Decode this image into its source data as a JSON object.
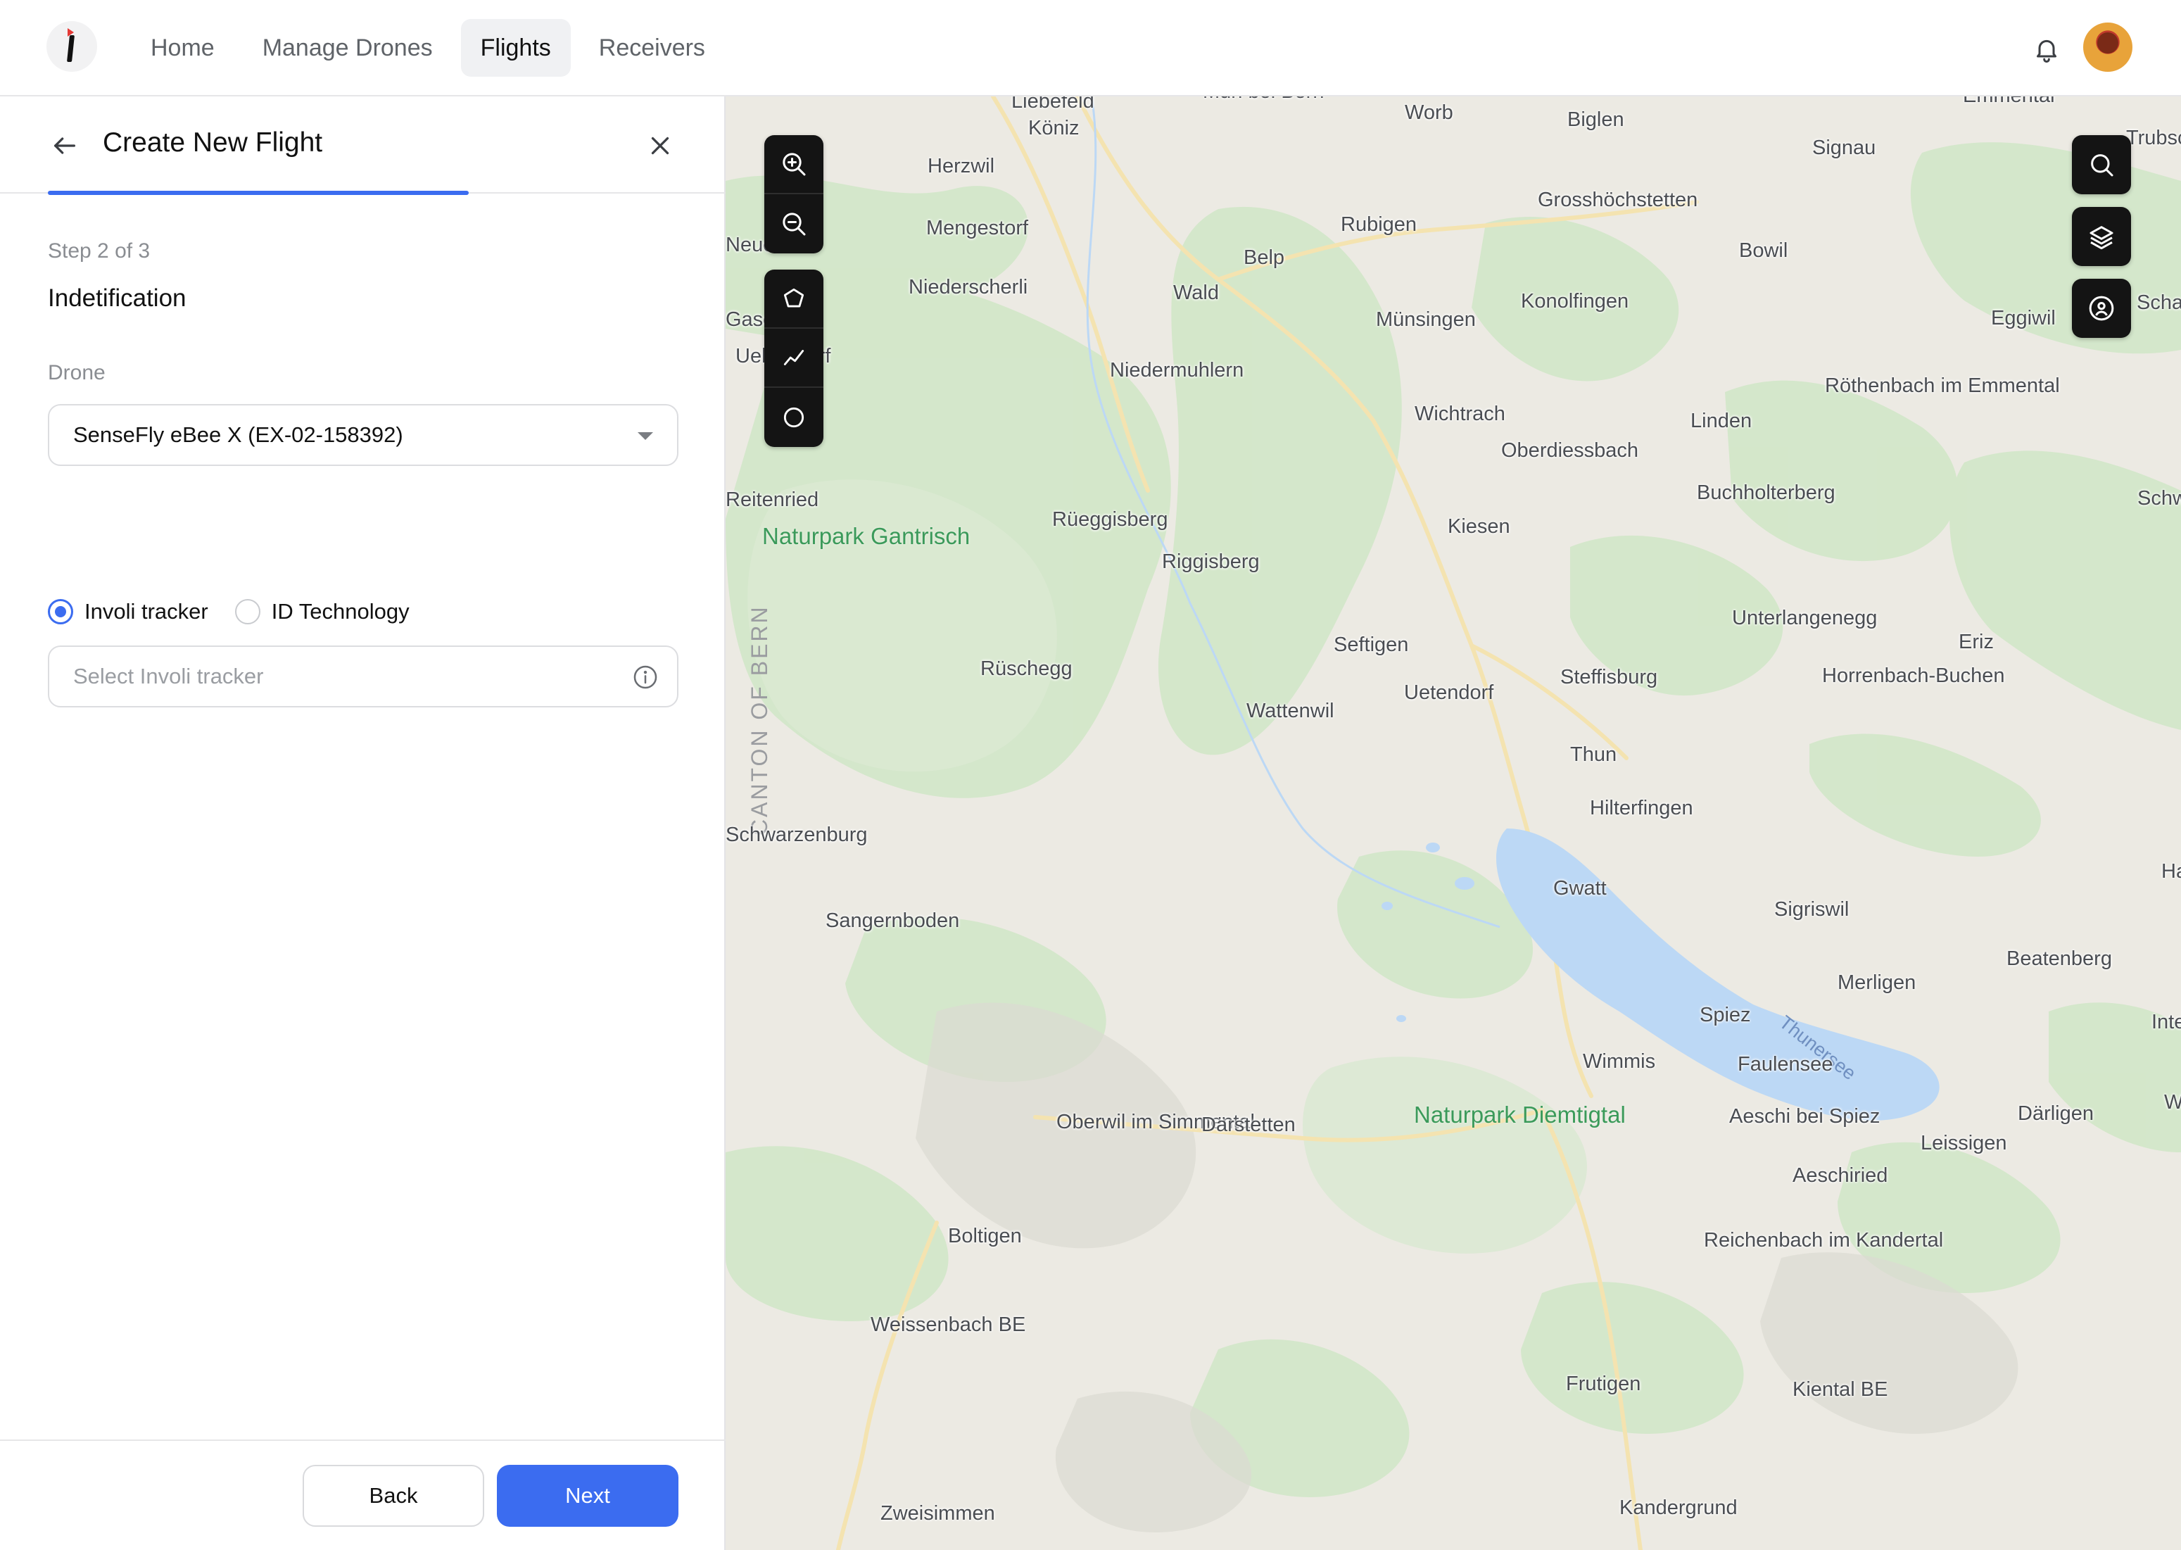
{
  "nav": {
    "items": [
      {
        "label": "Home",
        "active": false
      },
      {
        "label": "Manage Drones",
        "active": false
      },
      {
        "label": "Flights",
        "active": true
      },
      {
        "label": "Receivers",
        "active": false
      }
    ]
  },
  "panel": {
    "title": "Create New Flight",
    "step": "Step 2 of 3",
    "progress_fraction": 0.67,
    "section": "Indetification",
    "drone_label": "Drone",
    "drone_value": "SenseFly eBee X (EX-02-158392)",
    "radio_options": [
      {
        "label": "Involi tracker",
        "checked": true
      },
      {
        "label": "ID Technology",
        "checked": false
      }
    ],
    "tracker_placeholder": "Select Involi tracker",
    "back_label": "Back",
    "next_label": "Next"
  },
  "map": {
    "places": [
      "Liebefeld",
      "Köniz",
      "Muri bei Bern",
      "Worb",
      "Biglen",
      "Emmental",
      "Signau",
      "Trubschac",
      "Herzwil",
      "Mengestorf",
      "Rubigen",
      "Belp",
      "Grosshöchstetten",
      "Bowil",
      "Neuen",
      "Niederscherli",
      "Wald",
      "Münsingen",
      "Konolfingen",
      "Eggiwil",
      "Schangnau",
      "Gasel",
      "Ueberstorf",
      "Niedermuhlern",
      "Wichtrach",
      "Oberdiessbach",
      "Linden",
      "Röthenbach im Emmental",
      "Schwarzenegg",
      "Buchholterberg",
      "Reitenried",
      "Rüeggisberg",
      "Riggisberg",
      "Kiesen",
      "Unterlangenegg",
      "Seftigen",
      "Eriz",
      "Rüschegg",
      "Uetendorf",
      "Steffisburg",
      "Horrenbach-Buchen",
      "Wattenwil",
      "Thun",
      "Schwarzenburg",
      "Hilterfingen",
      "Gwatt",
      "Sigriswil",
      "Habkern",
      "Sangernboden",
      "Beatenberg",
      "Merligen",
      "Spiez",
      "Interlaken",
      "Wimmis",
      "Faulensee",
      "Oberwil im Simmental",
      "Därstetten",
      "Aeschi bei Spiez",
      "Därligen",
      "Leissigen",
      "Wilderswil",
      "Aeschiried",
      "Boltigen",
      "Reichenbach im Kandertal",
      "Zweisimmen",
      "Weissenbach BE",
      "Frutigen",
      "Kiental BE",
      "Kandergrund"
    ],
    "parks": [
      "Naturpark Gantrisch",
      "Naturpark Diemtigtal"
    ],
    "region_label": "CANTON OF BERN",
    "lake_label": "Thunersee",
    "colors": {
      "lake": "#bcd8f5",
      "forest": "#cfe6c6",
      "park": "#dcead3",
      "land": "#ecebe4",
      "accent": "#3b6cf0"
    }
  }
}
